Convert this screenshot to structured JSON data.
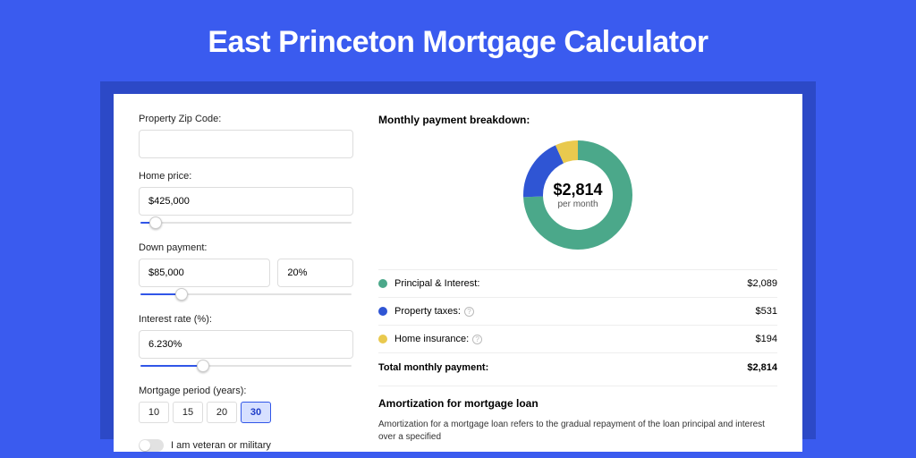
{
  "page_title": "East Princeton Mortgage Calculator",
  "colors": {
    "accent": "#3A5BEF",
    "green": "#4BA88A",
    "blue": "#2F55D4",
    "yellow": "#E9C94E"
  },
  "form": {
    "zip": {
      "label": "Property Zip Code:",
      "value": ""
    },
    "price": {
      "label": "Home price:",
      "value": "$425,000",
      "slider_pct": 8
    },
    "down": {
      "label": "Down payment:",
      "value": "$85,000",
      "pct_value": "20%",
      "slider_pct": 20
    },
    "rate": {
      "label": "Interest rate (%):",
      "value": "6.230%",
      "slider_pct": 30
    },
    "period": {
      "label": "Mortgage period (years):",
      "options": [
        "10",
        "15",
        "20",
        "30"
      ],
      "active": "30"
    },
    "veteran_label": "I am veteran or military"
  },
  "breakdown": {
    "title": "Monthly payment breakdown:",
    "total_value": "$2,814",
    "total_sub": "per month",
    "rows": [
      {
        "swatch": "green",
        "label": "Principal & Interest:",
        "info": false,
        "value": "$2,089"
      },
      {
        "swatch": "blue",
        "label": "Property taxes:",
        "info": true,
        "value": "$531"
      },
      {
        "swatch": "yellow",
        "label": "Home insurance:",
        "info": true,
        "value": "$194"
      }
    ],
    "total_row": {
      "label": "Total monthly payment:",
      "value": "$2,814"
    }
  },
  "chart_data": {
    "type": "pie",
    "title": "Monthly payment breakdown:",
    "series": [
      {
        "name": "Principal & Interest",
        "value": 2089,
        "color": "#4BA88A"
      },
      {
        "name": "Property taxes",
        "value": 531,
        "color": "#2F55D4"
      },
      {
        "name": "Home insurance",
        "value": 194,
        "color": "#E9C94E"
      }
    ],
    "center_label": "$2,814",
    "center_sub": "per month"
  },
  "amortization": {
    "title": "Amortization for mortgage loan",
    "text": "Amortization for a mortgage loan refers to the gradual repayment of the loan principal and interest over a specified"
  }
}
